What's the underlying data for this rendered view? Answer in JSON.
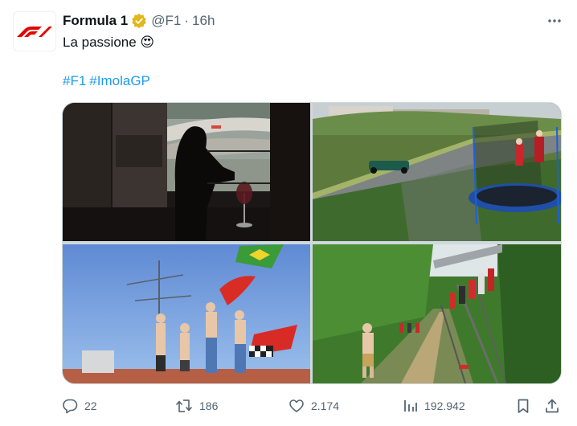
{
  "author": {
    "name": "Formula 1",
    "handle": "@F1",
    "time": "16h",
    "verified": true,
    "brand_color": "#e10600",
    "badge_color": "#e2b719"
  },
  "tweet": {
    "text": "La passione",
    "emoji": "😍",
    "hashtags": [
      "#F1",
      "#ImolaGP"
    ]
  },
  "media": {
    "count": 4
  },
  "actions": {
    "replies": "22",
    "reposts": "186",
    "likes": "2.174",
    "views": "192.942"
  },
  "icons": [
    "more-icon",
    "reply-icon",
    "repost-icon",
    "like-icon",
    "views-icon",
    "bookmark-icon",
    "share-icon"
  ],
  "colors": {
    "link": "#1d9bf0",
    "muted": "#536471",
    "text": "#0f1419"
  }
}
